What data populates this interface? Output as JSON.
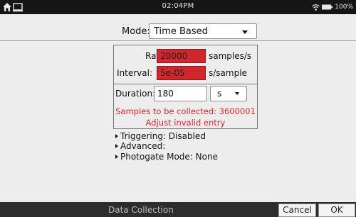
{
  "statusbar": {
    "time": "02:04PM",
    "battery_label": "100%"
  },
  "mode": {
    "label": "Mode:",
    "value": "Time Based"
  },
  "rate": {
    "label": "Rate:",
    "value": "20000",
    "unit": "samples/s"
  },
  "interval": {
    "label": "Interval:",
    "value": "5e-05",
    "unit": "s/sample"
  },
  "duration": {
    "label": "Duration:",
    "value": "180",
    "unit": "s"
  },
  "warnings": {
    "samples": "Samples to be collected: 3600001",
    "adjust": "Adjust invalid entry"
  },
  "expanders": [
    "Triggering: Disabled",
    "Advanced:",
    "Photogate Mode: None"
  ],
  "bottombar": {
    "title": "Data Collection",
    "cancel_label": "Cancel",
    "ok_label": "OK"
  },
  "colors": {
    "invalid": "#d0262e",
    "warning_text": "#e3232c",
    "statusbar": "#161616",
    "bottombar": "#2d2d2d"
  }
}
